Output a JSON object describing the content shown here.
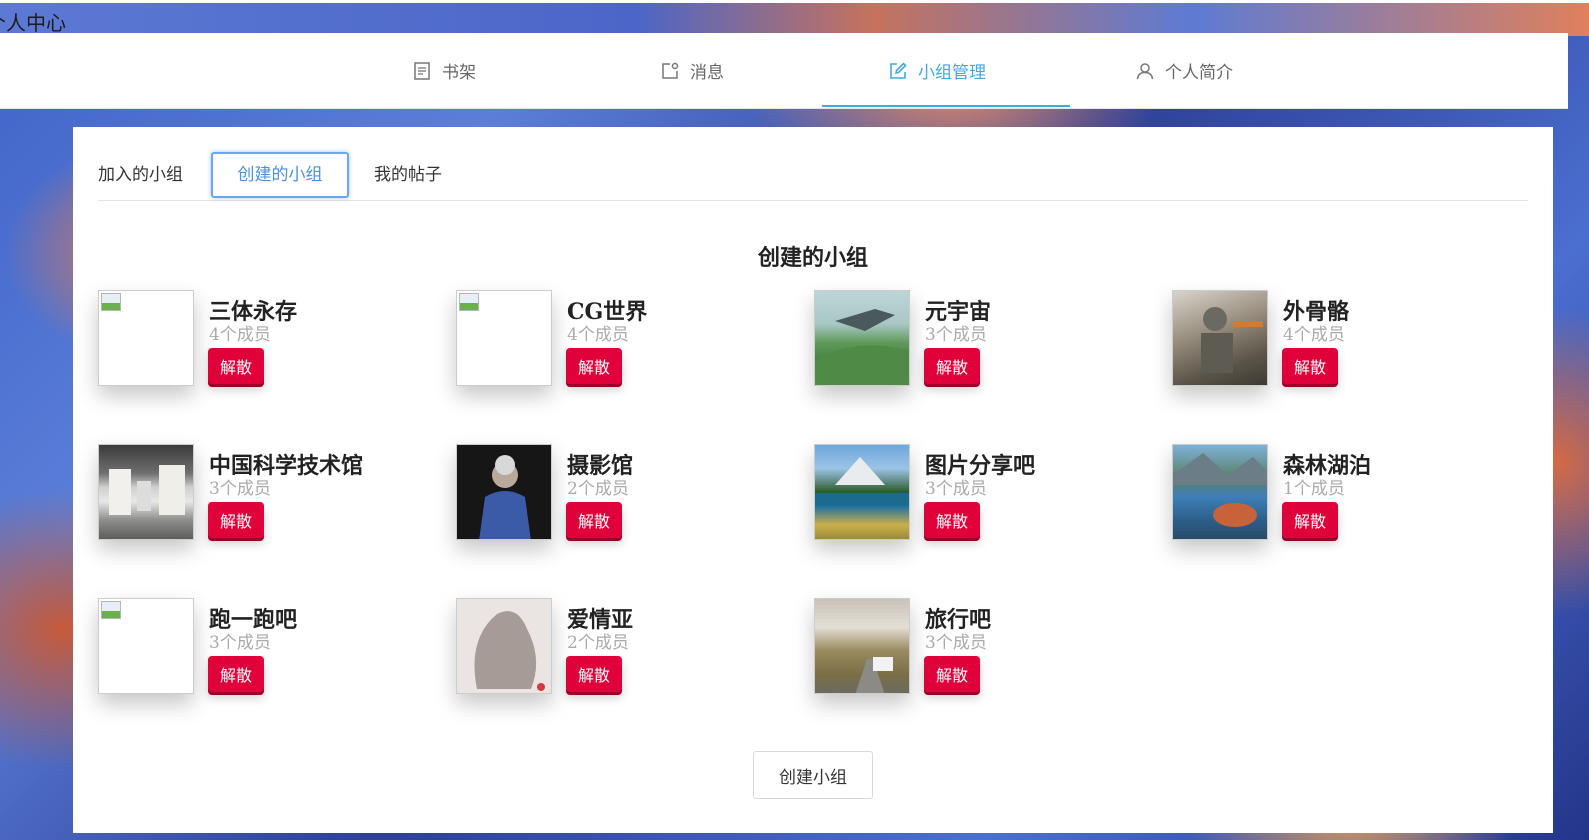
{
  "topbar": {
    "title": "个人中心"
  },
  "nav": {
    "items": [
      {
        "label": "书架",
        "icon": "book-list-icon",
        "active": false
      },
      {
        "label": "消息",
        "icon": "message-icon",
        "active": false
      },
      {
        "label": "小组管理",
        "icon": "edit-icon",
        "active": true
      },
      {
        "label": "个人简介",
        "icon": "user-icon",
        "active": false
      }
    ]
  },
  "tabs": [
    {
      "label": "加入的小组",
      "active": false
    },
    {
      "label": "创建的小组",
      "active": true
    },
    {
      "label": "我的帖子",
      "active": false
    }
  ],
  "section_title": "创建的小组",
  "groups": [
    {
      "name": "三体永存",
      "members": "4个成员",
      "action": "解散",
      "image": "broken"
    },
    {
      "name": "CG世界",
      "members": "4个成员",
      "action": "解散",
      "image": "broken"
    },
    {
      "name": "元宇宙",
      "members": "3个成员",
      "action": "解散",
      "image": "mecha-landscape"
    },
    {
      "name": "外骨骼",
      "members": "4个成员",
      "action": "解散",
      "image": "exoskeleton-soldier"
    },
    {
      "name": "中国科学技术馆",
      "members": "3个成员",
      "action": "解散",
      "image": "museum-hall"
    },
    {
      "name": "摄影馆",
      "members": "2个成员",
      "action": "解散",
      "image": "elderly-portrait"
    },
    {
      "name": "图片分享吧",
      "members": "3个成员",
      "action": "解散",
      "image": "mountain-lake"
    },
    {
      "name": "森林湖泊",
      "members": "1个成员",
      "action": "解散",
      "image": "forest-lake"
    },
    {
      "name": "跑一跑吧",
      "members": "3个成员",
      "action": "解散",
      "image": "broken"
    },
    {
      "name": "爱情亚",
      "members": "2个成员",
      "action": "解散",
      "image": "double-exposure"
    },
    {
      "name": "旅行吧",
      "members": "3个成员",
      "action": "解散",
      "image": "road-trip"
    }
  ],
  "create_button": "创建小组"
}
